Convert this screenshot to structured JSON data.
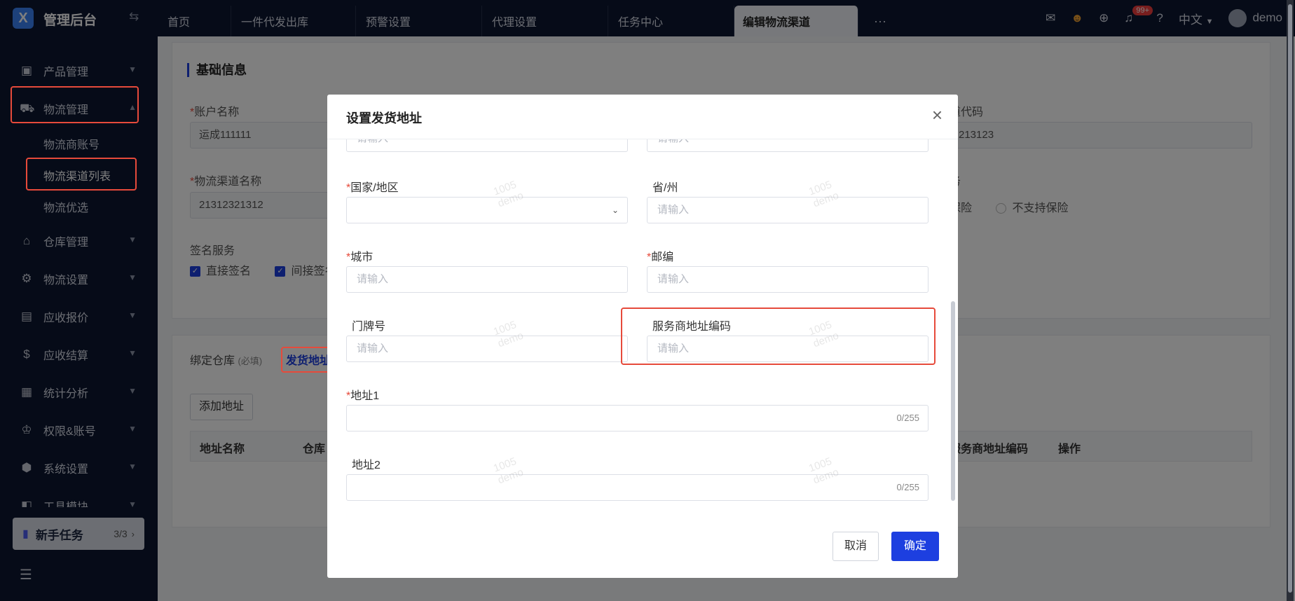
{
  "app": {
    "logo_letter": "X",
    "title": "管理后台",
    "collapse_icon": "⇆"
  },
  "sidebar": {
    "items": [
      {
        "label": "产品管理",
        "icon": "box-icon"
      },
      {
        "label": "物流管理",
        "icon": "truck-icon"
      },
      {
        "label": "仓库管理",
        "icon": "warehouse-icon"
      },
      {
        "label": "物流设置",
        "icon": "settings-icon"
      },
      {
        "label": "应收报价",
        "icon": "quote-icon"
      },
      {
        "label": "应收结算",
        "icon": "dollar-icon"
      },
      {
        "label": "统计分析",
        "icon": "chart-icon"
      },
      {
        "label": "权限&账号",
        "icon": "org-icon"
      },
      {
        "label": "系统设置",
        "icon": "hexagon-icon"
      },
      {
        "label": "工具模块",
        "icon": "tool-icon"
      }
    ],
    "sub_items": [
      "物流商账号",
      "物流渠道列表",
      "物流优选"
    ],
    "newbie": {
      "label": "新手任务",
      "count": "3/3"
    }
  },
  "topbar": {
    "tabs": [
      "首页",
      "一件代发出库",
      "预警设置",
      "代理设置",
      "任务中心",
      "编辑物流渠道"
    ],
    "more": "···",
    "badge": "99+",
    "language": "中文",
    "user": "demo"
  },
  "background": {
    "section_title": "基础信息",
    "account_label": "账户名称",
    "account_value": "运成111111",
    "code_label": "道代码",
    "code_value": "213123",
    "channel_label": "物流渠道名称",
    "channel_value": "21312321312",
    "insurance_label": "务",
    "insurance_opt1": "保险",
    "insurance_opt2": "不支持保险",
    "sign_label": "签名服务",
    "sign_opt1": "直接签名",
    "sign_opt2": "间接签名",
    "tab_warehouse": "绑定仓库",
    "tab_warehouse_note": "(必填)",
    "tab_address": "发货地址",
    "add_address": "添加地址",
    "columns": [
      "地址名称",
      "仓库",
      "服务商地址编码",
      "操作"
    ]
  },
  "modal": {
    "title": "设置发货地址",
    "placeholder": "请输入",
    "country_label": "国家/地区",
    "state_label": "省/州",
    "city_label": "城市",
    "zip_label": "邮编",
    "house_label": "门牌号",
    "service_code_label": "服务商地址编码",
    "address1_label": "地址1",
    "address2_label": "地址2",
    "counter": "0/255",
    "cancel": "取消",
    "confirm": "确定"
  },
  "watermark": {
    "line1": "1005",
    "line2": "demo"
  }
}
